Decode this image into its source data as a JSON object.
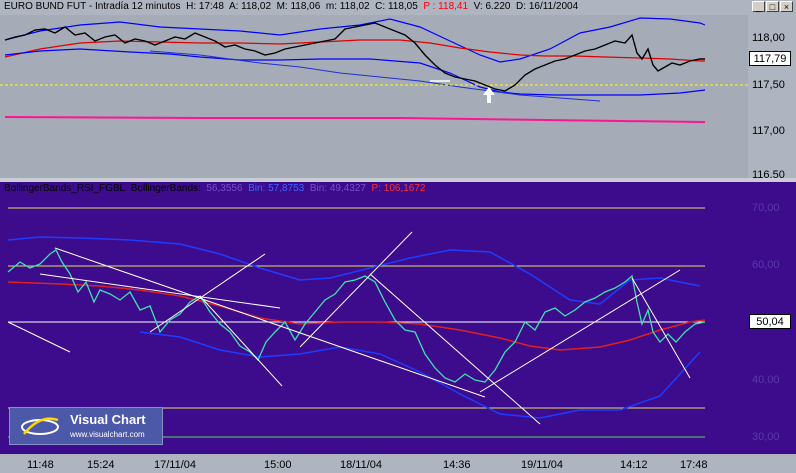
{
  "title": {
    "instrument": "EURO BUND FUT",
    "period": "Intradía 12 minutos",
    "h": "H: 17:48",
    "a": "A: 118,02",
    "max": "M: 118,06",
    "min": "m: 118,02",
    "close": "C: 118,05",
    "p": "P : 118,41",
    "vol": "V: 6.220",
    "date": "D: 16/11/2004"
  },
  "window_buttons": [
    "_",
    "□",
    "×"
  ],
  "price_axis": {
    "labels": [
      "118,00",
      "117,50",
      "117,00",
      "116,50"
    ],
    "current_price": "117,79"
  },
  "indicator": {
    "name": "BollingerBands_RSI_FGBL",
    "name2": "BollingerBands:",
    "v1": "56,3556",
    "v2": "Bin: 57,8753",
    "v3": "Bin: 49,4327",
    "p": "P: 106,1672",
    "axis_labels": [
      "70,00",
      "60,00",
      "40,00",
      "30,00"
    ],
    "current_value": "50,04"
  },
  "time_axis": [
    "11:48",
    "15:24",
    "17/11/04",
    "15:00",
    "18/11/04",
    "14:36",
    "19/11/04",
    "14:12",
    "17:48"
  ],
  "logo": {
    "name": "Visual Chart",
    "url": "www.visualchart.com"
  },
  "colors": {
    "price_bg": "#a5acb8",
    "indicator_bg": "#3c0c8c",
    "bollinger_band": "#0000ff",
    "moving_average": "#ff0000",
    "support_line": "#ff1493",
    "reference_line": "#ffff00",
    "rsi_line": "#40e0b0",
    "trend_lines": "#ffffff"
  }
}
